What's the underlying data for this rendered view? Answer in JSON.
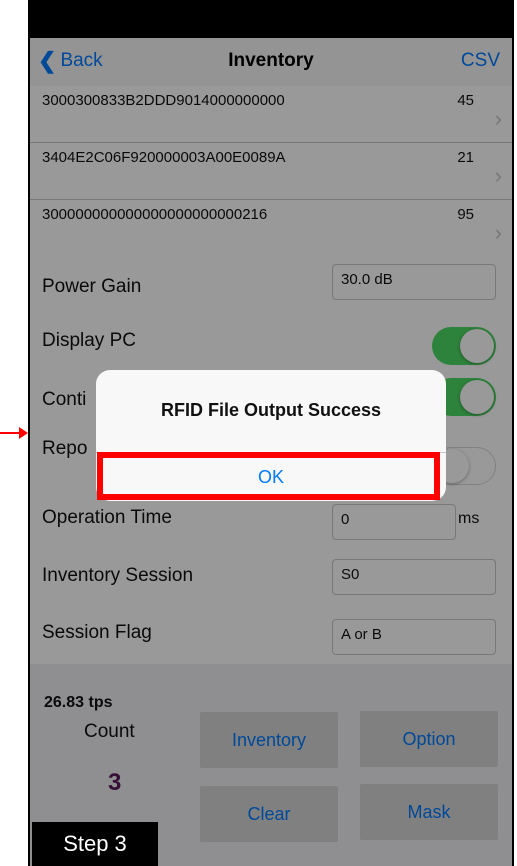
{
  "nav": {
    "back_label": "Back",
    "title": "Inventory",
    "action_label": "CSV"
  },
  "tags": [
    {
      "epc": "3000300833B2DDD9014000000000",
      "count": "45"
    },
    {
      "epc": "3404E2C06F920000003A00E0089A",
      "count": "21"
    },
    {
      "epc": "300000000000000000000000216",
      "count": "95"
    }
  ],
  "settings": {
    "power_gain_label": "Power Gain",
    "power_gain_value": "30.0 dB",
    "display_pc_label": "Display PC",
    "display_pc_on": true,
    "continuous_label": "Conti",
    "continuous_on": true,
    "report_label": "Repo",
    "report_on": false,
    "operation_time_label": "Operation Time",
    "operation_time_value": "0",
    "operation_time_unit": "ms",
    "session_label": "Inventory Session",
    "session_value": "S0",
    "session_flag_label": "Session Flag",
    "session_flag_value": "A or B"
  },
  "stats": {
    "rate": "26.83 tps",
    "count_label": "Count",
    "count_value": "3"
  },
  "buttons": {
    "inventory": "Inventory",
    "option": "Option",
    "clear": "Clear",
    "mask": "Mask"
  },
  "alert": {
    "title": "RFID File Output Success",
    "ok_label": "OK"
  },
  "annotation": {
    "step_label": "Step 3"
  },
  "colors": {
    "accent": "#007aff",
    "toggle_on": "#4cd964",
    "highlight": "#ff0000",
    "count": "#5a1a5a"
  }
}
